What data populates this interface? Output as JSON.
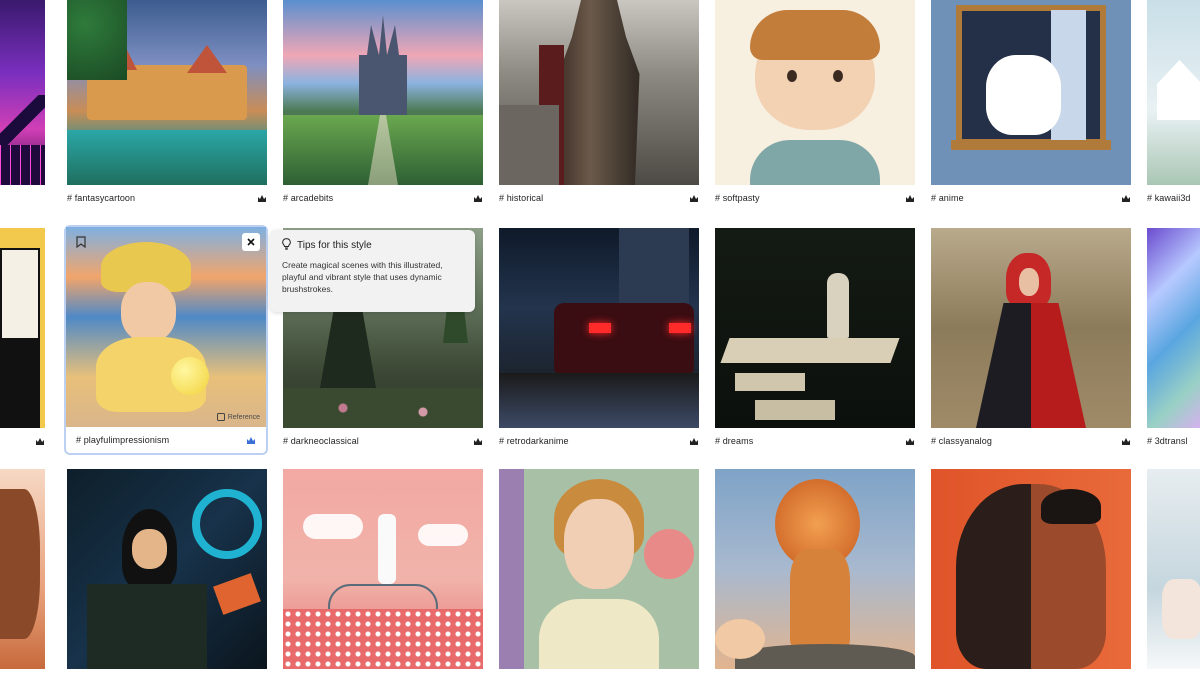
{
  "grid": {
    "row1": [
      {
        "tag": "",
        "premium": false
      },
      {
        "tag": "# fantasycartoon",
        "premium": true
      },
      {
        "tag": "# arcadebits",
        "premium": true
      },
      {
        "tag": "# historical",
        "premium": true
      },
      {
        "tag": "# softpasty",
        "premium": true
      },
      {
        "tag": "# anime",
        "premium": true
      },
      {
        "tag": "# kawaii3d",
        "premium": false
      }
    ],
    "row2": [
      {
        "tag": "",
        "premium": true
      },
      {
        "tag": "# playfulimpressionism",
        "premium": true
      },
      {
        "tag": "# darkneoclassical",
        "premium": true
      },
      {
        "tag": "# retrodarkanime",
        "premium": true
      },
      {
        "tag": "# dreams",
        "premium": true
      },
      {
        "tag": "# classyanalog",
        "premium": true
      },
      {
        "tag": "# 3dtransl",
        "premium": false
      }
    ]
  },
  "selected_card": {
    "reference_label": "Reference",
    "close_icon": "close-icon",
    "bookmark_icon": "bookmark-icon"
  },
  "tooltip": {
    "title": "Tips for this style",
    "body": "Create magical scenes with this illustrated, playful and vibrant style that uses dynamic brushstrokes.",
    "icon": "lightbulb-icon"
  },
  "colors": {
    "selected_outline": "#bcd0f2",
    "premium_selected": "#3b6fd6"
  }
}
